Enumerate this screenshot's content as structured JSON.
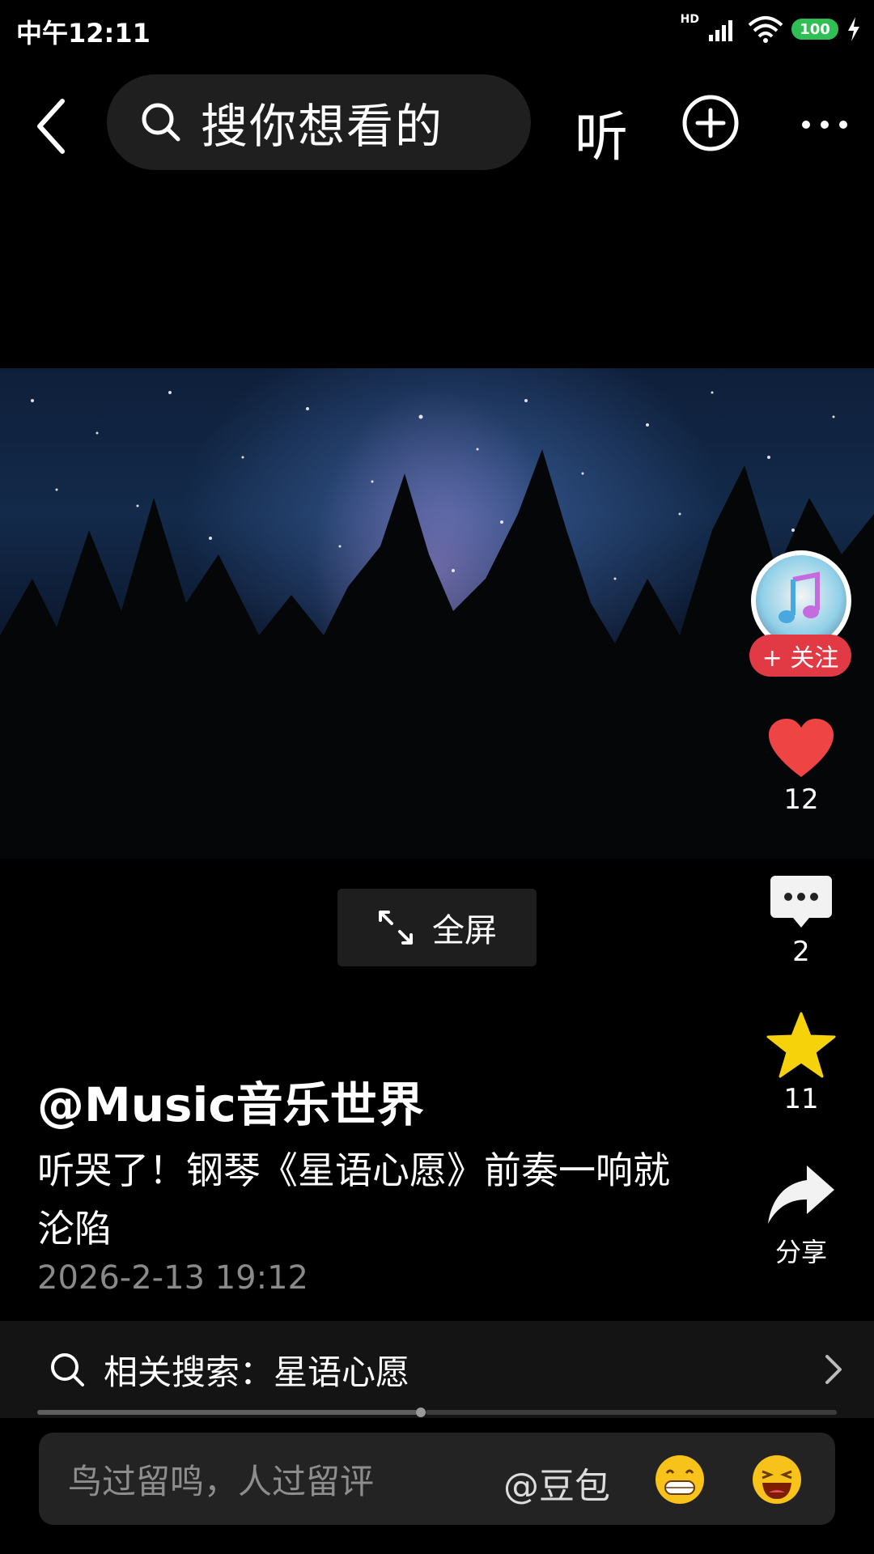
{
  "status_bar": {
    "time": "中午12:11",
    "battery": "100",
    "network_badge": "HD"
  },
  "top_bar": {
    "search_placeholder": "搜你想看的",
    "listen_label": "听"
  },
  "video": {
    "fullscreen_label": "全屏"
  },
  "right_rail": {
    "avatar_icon": "music-note-icon",
    "follow_label": "+ 关注",
    "like_count": "12",
    "comment_count": "2",
    "favorite_count": "11",
    "share_label": "分享"
  },
  "post": {
    "author": "@Music音乐世界",
    "title": "听哭了！钢琴《星语心愿》前奏一响就沦陷",
    "date": "2026-2-13 19:12"
  },
  "related_search": {
    "label": "相关搜索：星语心愿"
  },
  "playback": {
    "progress": 0.48
  },
  "comment_bar": {
    "placeholder": "鸟过留鸣，人过留评",
    "mention_label": "@豆包"
  },
  "colors": {
    "accent_red": "#e23a45",
    "like_red": "#ef4444",
    "star_yellow": "#f6d20b"
  }
}
